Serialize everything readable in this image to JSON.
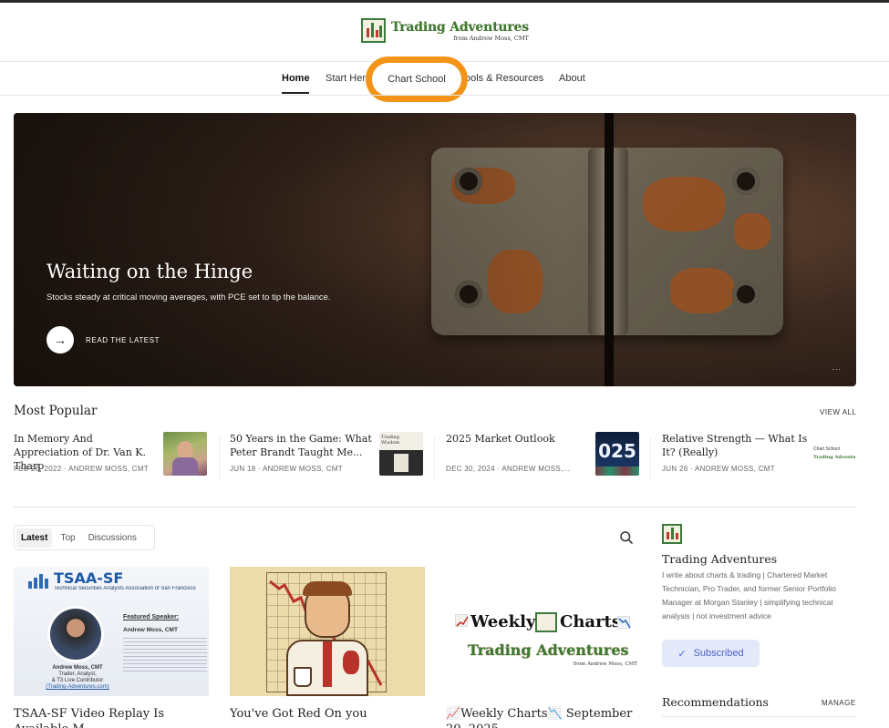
{
  "brand": {
    "title": "Trading Adventures",
    "subtitle": "from Andrew Moss, CMT"
  },
  "nav": {
    "items": [
      "Home",
      "Start Her",
      "Chart School",
      "ools & Resources",
      "About"
    ],
    "active": "Home",
    "highlighted": "Chart School"
  },
  "hero": {
    "title": "Waiting on the Hinge",
    "subtitle": "Stocks steady at critical moving averages, with PCE set to tip the balance.",
    "cta": "READ THE LATEST",
    "more": "..."
  },
  "most_popular": {
    "heading": "Most Popular",
    "view_all": "VIEW ALL",
    "items": [
      {
        "title": "In Memory And Appreciation of Dr. Van K. Tharp",
        "meta": "FEB 26, 2022 · ANDREW MOSS, CMT"
      },
      {
        "title": "50 Years in the Game: What Peter Brandt Taught Me...",
        "meta": "JUN 18 · ANDREW MOSS, CMT"
      },
      {
        "title": "2025 Market Outlook",
        "meta": "DEC 30, 2024 · ANDREW MOSS,..."
      },
      {
        "title": "Relative Strength — What Is It? (Really)",
        "meta": "JUN 26 · ANDREW MOSS, CMT"
      }
    ],
    "thumb_texts": {
      "wisdom": "Trading\nWisdom",
      "outlook": "025",
      "chart_school": "Chart School"
    }
  },
  "tabs": {
    "items": [
      "Latest",
      "Top",
      "Discussions"
    ],
    "active": "Latest"
  },
  "posts": [
    {
      "title": "TSAA-SF Video Replay Is Available M..."
    },
    {
      "title": "You've Got Red On you"
    },
    {
      "title": "📈Weekly Charts📉 September 20, 2025"
    }
  ],
  "tsaa_card": {
    "logo": "TSAA-SF",
    "org": "Technical Securities Analysts Association of San Francisco",
    "featured": "Featured Speaker:",
    "speaker": "Andrew Moss, CMT",
    "role1": "Andrew Moss, CMT",
    "role2": "Trader, Analyst,",
    "role3": "& T3 Live Contributor",
    "link": "(Trading-Adventures.com)"
  },
  "weekly_card": {
    "line1a": "Weekly",
    "line1b": "Charts",
    "line2": "Trading Adventures",
    "line3": "from Andrew Moss, CMT"
  },
  "sidebar": {
    "name": "Trading Adventures",
    "description": "I write about charts & trading | Chartered Market Technician, Pro Trader, and former Senior Portfolio Manager at Morgan Stanley | simplifying technical analysis | not investment advice",
    "subscribe": "Subscribed",
    "recommendations": "Recommendations",
    "manage": "MANAGE"
  },
  "colors": {
    "accent_orange": "#f39419",
    "brand_green": "#3d7a32",
    "subscribe_bg": "#e4e9fa",
    "subscribe_fg": "#4c63c6"
  }
}
